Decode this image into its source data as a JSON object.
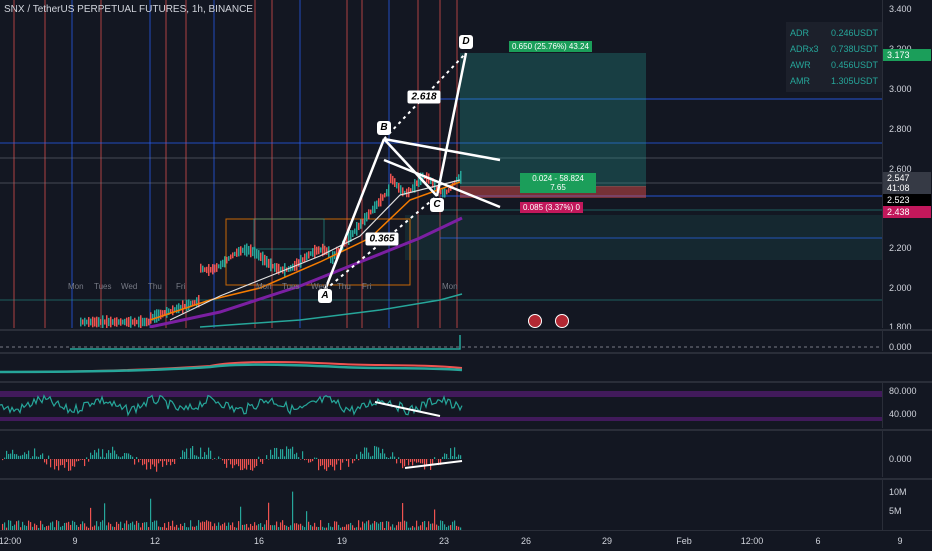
{
  "header": {
    "title": "SNX / TetherUS PERPETUAL FUTURES, 1h, BINANCE"
  },
  "stats": [
    {
      "key": "ADR",
      "value": "0.246USDT"
    },
    {
      "key": "ADRx3",
      "value": "0.738USDT"
    },
    {
      "key": "AWR",
      "value": "0.456USDT"
    },
    {
      "key": "AMR",
      "value": "1.305USDT"
    }
  ],
  "price_axis": {
    "ticks": [
      "3.400",
      "3.200",
      "3.000",
      "2.800",
      "2.600",
      "2.200",
      "2.000",
      "1.800"
    ],
    "tags": {
      "high": "3.173",
      "current": "2.547",
      "countdown": "41:08",
      "mid": "2.523",
      "low": "2.438"
    }
  },
  "indicator_axes": {
    "pane1": [
      "0.000"
    ],
    "pane2": [
      "80.000",
      "40.000"
    ],
    "pane3": [
      "0.000"
    ],
    "pane4": [
      "10M",
      "5M"
    ]
  },
  "pattern": {
    "points": [
      "A",
      "B",
      "C",
      "D"
    ],
    "ratios": {
      "bd": "2.618",
      "ac": "0.365"
    }
  },
  "trade": {
    "target": "0.650 (25.76%) 43.24",
    "position_1": "0.024 - 58.824",
    "position_2": "7.65",
    "stop": "0.085 (3.37%) 0"
  },
  "days": [
    "Mon",
    "Tues",
    "Wed",
    "Thu",
    "Fri",
    "Mon",
    "Tues",
    "Wed",
    "Thu",
    "Fri",
    "Mon"
  ],
  "time_axis": [
    "12:00",
    "9",
    "12",
    "16",
    "19",
    "23",
    "26",
    "29",
    "Feb",
    "12:00",
    "6",
    "9"
  ],
  "colors": {
    "bg": "#131722",
    "green": "#26a69a",
    "red": "#ef5350",
    "purple": "#7b1fa2",
    "grid": "#2a2e39"
  }
}
